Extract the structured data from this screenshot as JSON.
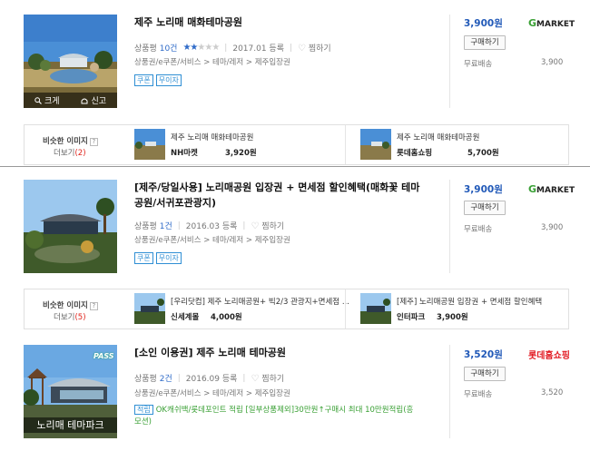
{
  "products": [
    {
      "title": "제주 노리매 매화테마공원",
      "rating_label": "상품평",
      "review_count": "10건",
      "rating_stars": 2,
      "rating_max": 5,
      "reg_date": "2017.01 등록",
      "wishlist": "찜하기",
      "category": "상품권/e쿠폰/서비스 > 테마/레저 > 제주입장권",
      "badges": [
        "쿠폰",
        "무이자"
      ],
      "price": "3,900원",
      "seller": "Gmarket",
      "buy_label": "구매하기",
      "ship_label": "무료배송",
      "ship_value": "3,900",
      "thumb_actions": [
        "크게",
        "신고"
      ]
    },
    {
      "title": "[제주/당일사용] 노리매공원 입장권 + 면세점 할인혜택(매화꽃 테마공원/서귀포관광지)",
      "rating_label": "상품평",
      "review_count": "1건",
      "reg_date": "2016.03 등록",
      "wishlist": "찜하기",
      "category": "상품권/e쿠폰/서비스 > 테마/레저 > 제주입장권",
      "badges": [
        "쿠폰",
        "무이자"
      ],
      "price": "3,900원",
      "seller": "Gmarket",
      "buy_label": "구매하기",
      "ship_label": "무료배송",
      "ship_value": "3,900"
    },
    {
      "title": "[소인 이용권] 제주 노리매 테마공원",
      "rating_label": "상품평",
      "review_count": "2건",
      "reg_date": "2016.09 등록",
      "wishlist": "찜하기",
      "category": "상품권/e쿠폰/서비스 > 테마/레저 > 제주입장권",
      "promo_tag": "적립",
      "promo_text": "OK캐쉬백/롯데포인트 적립 [일부상품제외]30만원↑구매시 최대 10만원적립(흥모션)",
      "price": "3,520원",
      "seller": "롯데홈쇼핑",
      "buy_label": "구매하기",
      "ship_label": "무료배송",
      "ship_value": "3,520",
      "thumb_caption": "노리매 테마파크",
      "thumb_logo": "PASS"
    }
  ],
  "similar_sections": [
    {
      "label": "비슷한 이미지",
      "help": "?",
      "more_label": "더보기",
      "more_count": "(2)",
      "items": [
        {
          "name": "제주 노리매 매화테마공원",
          "shop": "NH마켓",
          "price": "3,920원"
        },
        {
          "name": "제주 노리매 매화테마공원",
          "shop": "롯데홈쇼핑",
          "price": "5,700원"
        }
      ]
    },
    {
      "label": "비슷한 이미지",
      "help": "?",
      "more_label": "더보기",
      "more_count": "(5)",
      "items": [
        {
          "name": "[우리닷컴] 제주 노리매공원+ 빅2/3 관광지+면세점 ...",
          "shop": "신세계몰",
          "price": "4,000원"
        },
        {
          "name": "[제주] 노리매공원 입장권 + 면세점 할인혜택",
          "shop": "인터파크",
          "price": "3,900원"
        }
      ]
    }
  ],
  "colors": {
    "price": "#2159b8",
    "gmarket_g": "#3aa035",
    "lotte": "#e21a22",
    "badge": "#2f8fd4",
    "more_count": "#e0231b"
  }
}
